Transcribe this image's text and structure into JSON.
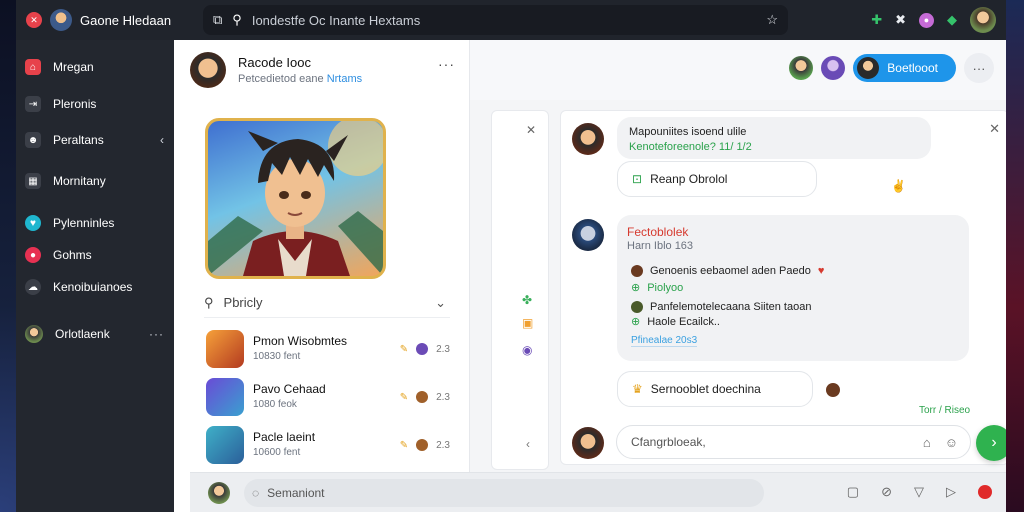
{
  "topbar": {
    "app_title": "Gaone Hledaan",
    "address_text": "Iondestfe Oc Inante Hextams",
    "icons": [
      "close-icon",
      "tab-icon",
      "pin-icon",
      "star-icon",
      "puzzle-icon",
      "x-icon",
      "profile-icon",
      "leaf-icon"
    ]
  },
  "sidebar": {
    "items": [
      {
        "label": "Mregan",
        "icon": "home-icon",
        "color": "#e7424b"
      },
      {
        "label": "Pleronis",
        "icon": "arrow-icon",
        "color": "#3b3f48"
      },
      {
        "label": "Peraltans",
        "icon": "people-icon",
        "color": "#3b3f48"
      },
      {
        "label": "Mornitany",
        "icon": "grid-icon",
        "color": "#3b3f48"
      },
      {
        "label": "Pylenninles",
        "icon": "heart-icon",
        "color": "#1fb6cf"
      },
      {
        "label": "Gohms",
        "icon": "circle-icon",
        "color": "#e73152"
      },
      {
        "label": "Kenoibuianoes",
        "icon": "cloud-icon",
        "color": "#3b3f48"
      },
      {
        "label": "Orlotlaenk",
        "icon": "user-icon",
        "color": "#3b3f48"
      }
    ],
    "more_label": "···"
  },
  "profile": {
    "name": "Racode Iooc",
    "subtitle": "Petcedietod eane",
    "subtitle_link": "Nrtams",
    "menu": "···"
  },
  "filter": {
    "label": "Pbricly"
  },
  "games": [
    {
      "title": "Pmon Wisobmtes",
      "meta": "10830 fent",
      "count": "2.3"
    },
    {
      "title": "Pavo Cehaad",
      "meta": "1080 feok",
      "count": "2.3"
    },
    {
      "title": "Pacle laeint",
      "meta": "10600 fent",
      "count": "2.3"
    }
  ],
  "right_header": {
    "button_label": "Boetlooot",
    "more": "···"
  },
  "messages": {
    "m1_title": "Mapouniites isoend ulile",
    "m1_sub": "Kenoteforeenole? 11/ 1/2",
    "m1_reply": "Reanp Obrolol",
    "m2_title": "Fectoblolek",
    "m2_time": "Harn Iblo 163",
    "m2_l1": "Genoenis eebaomel aden Paedo",
    "m2_l2": "Piolyoo",
    "m2_l3": "Panfelemotelecaana Siiten taoan",
    "m2_l4": "Haole Ecailck..",
    "m2_l5": "Pfinealae 20s3",
    "m3_reply": "Sernooblet doechina",
    "timestamp": "Torr / Riseo"
  },
  "composer": {
    "placeholder": "Cfangrbloeak,"
  },
  "bottombar": {
    "search_placeholder": "Semaniont"
  }
}
